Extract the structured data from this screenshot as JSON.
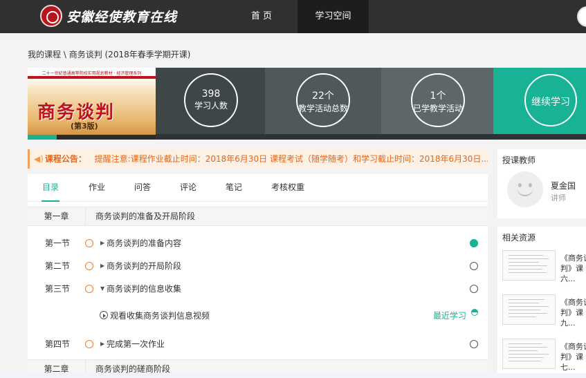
{
  "nav": {
    "site_title": "安徽经使教育在线",
    "items": [
      "首 页",
      "学习空间"
    ]
  },
  "breadcrumb": {
    "root": "我的课程",
    "sep": " \\ ",
    "course": "商务谈判 (2018年春季学期开课)"
  },
  "book_cover": {
    "series": "二十一世纪普通高等院校实用规划教材 · 经济管理系列",
    "title": "商务谈判",
    "edition": "(第3版)"
  },
  "stats": [
    {
      "number": "398",
      "label": "学习人数"
    },
    {
      "number": "22个",
      "label": "教学活动总数"
    },
    {
      "number": "1个",
      "label": "已学教学活动"
    }
  ],
  "continue_label": "继续学习",
  "notice": {
    "label": "课程公告：",
    "text": "提醒注意:课程作业截止时间：2018年6月30日 课程考试（随学随考）和学习截止时间：2018年6月30日..."
  },
  "tabs": [
    "目录",
    "作业",
    "问答",
    "评论",
    "笔记",
    "考核权重"
  ],
  "chapters": [
    {
      "number": "第一章",
      "title": "商务谈判的准备及开局阶段"
    },
    {
      "number": "第二章",
      "title": "商务谈判的磋商阶段"
    }
  ],
  "sections": [
    {
      "number": "第一节",
      "title": "商务谈判的准备内容",
      "arrow": "▶",
      "done": true
    },
    {
      "number": "第二节",
      "title": "商务谈判的开局阶段",
      "arrow": "▶",
      "done": false
    },
    {
      "number": "第三节",
      "title": "商务谈判的信息收集",
      "arrow": "▼",
      "done": false
    },
    {
      "number": "第四节",
      "title": "完成第一次作业",
      "arrow": "▶",
      "done": false
    }
  ],
  "video": {
    "title": "观看收集商务谈判信息视频",
    "status": "最近学习"
  },
  "teacher": {
    "section_title": "授课教师",
    "name": "夏金国",
    "role": "讲师"
  },
  "resources": {
    "section_title": "相关资源",
    "items": [
      {
        "line1": "《商务谈",
        "line2": "判》课",
        "line3": "六..."
      },
      {
        "line1": "《商务谈",
        "line2": "判》课",
        "line3": "九..."
      },
      {
        "line1": "《商务谈",
        "line2": "判》课",
        "line3": "七..."
      }
    ]
  },
  "colors": {
    "accent": "#17b394",
    "nav_bg": "#303030",
    "notice_text": "#e3681a",
    "ring": "#f07a2c"
  }
}
